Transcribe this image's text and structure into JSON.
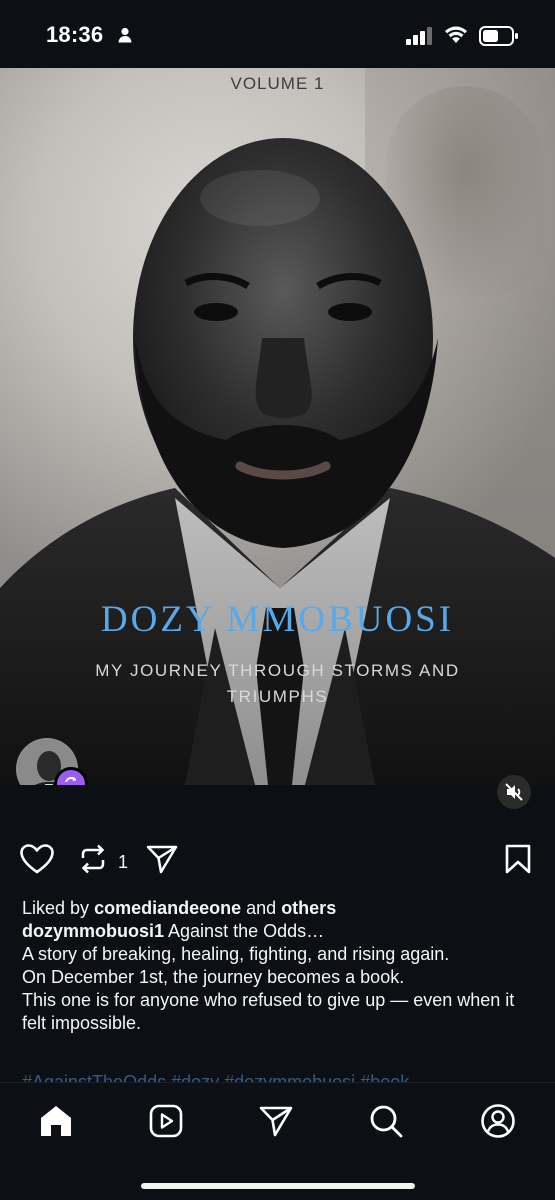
{
  "status_bar": {
    "time": "18:36"
  },
  "post": {
    "cover": {
      "volume": "VOLUME 1",
      "author": "DOZY MMOBUOSI",
      "subtitle": "MY JOURNEY THROUGH STORMS AND TRIUMPHS"
    },
    "actions": {
      "repost_count": "1"
    },
    "likes": {
      "prefix": "Liked by",
      "user": "comediandeeone",
      "and": "and",
      "others": "others"
    },
    "caption": {
      "username": "dozymmobuosi1",
      "first_line": "Against the Odds…",
      "lines": [
        "A story of breaking, healing, fighting, and rising again.",
        "On December 1st, the journey becomes a book.",
        "This one is for anyone who refused to give up — even when it felt impossible."
      ],
      "hashtags": "#AgainstTheOdds #dozy #dozymmobuosi #book"
    }
  },
  "colors": {
    "background": "#0c1014",
    "accent_repost": "#9b5cf2",
    "author_blue": "#59a9e8"
  },
  "nav": {
    "items": [
      "home-icon",
      "reels-icon",
      "messages-icon",
      "search-icon",
      "profile-icon"
    ]
  }
}
